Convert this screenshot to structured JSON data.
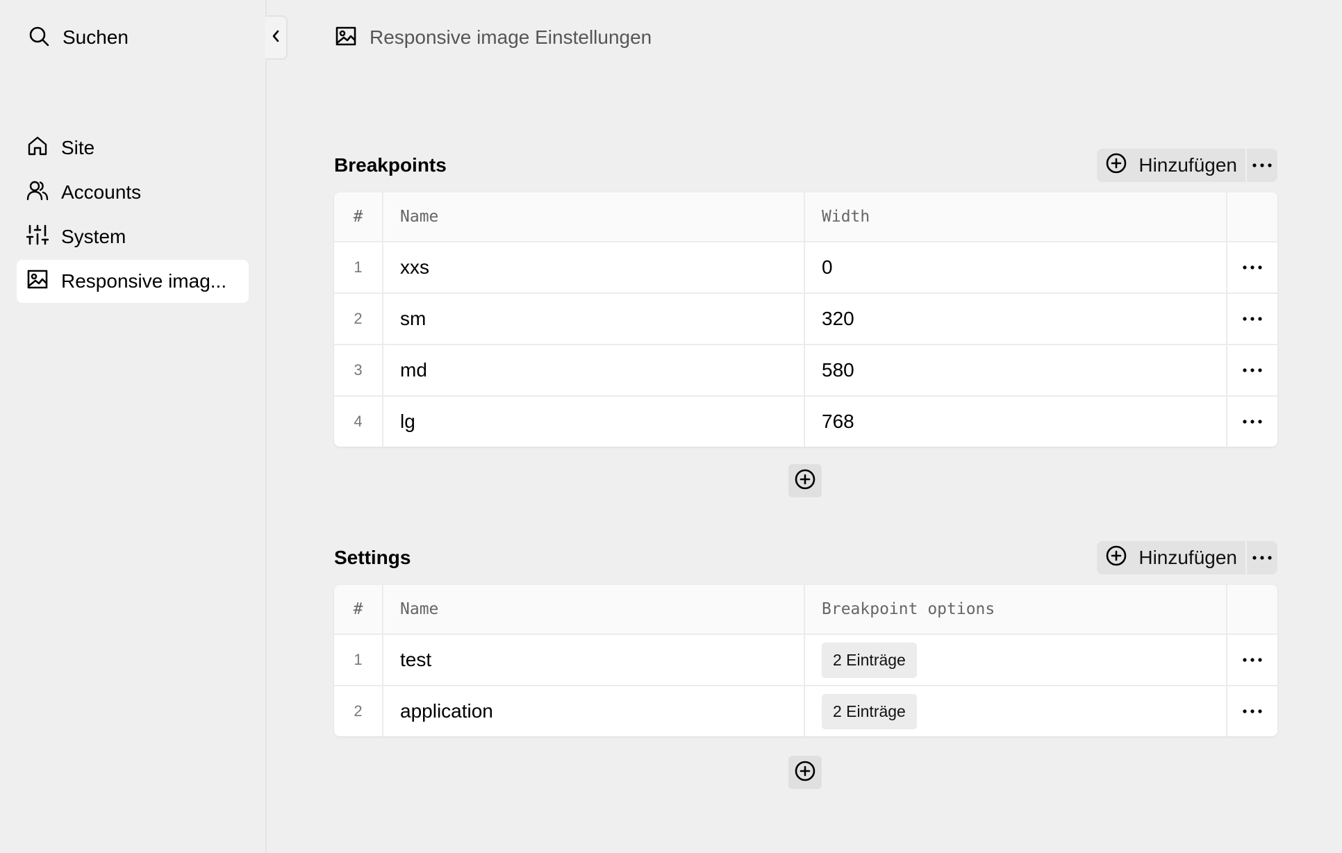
{
  "sidebar": {
    "search_label": "Suchen",
    "items": [
      {
        "label": "Site",
        "icon": "home-icon"
      },
      {
        "label": "Accounts",
        "icon": "users-icon"
      },
      {
        "label": "System",
        "icon": "sliders-icon"
      },
      {
        "label": "Responsive imag...",
        "icon": "image-icon",
        "active": true
      }
    ]
  },
  "header": {
    "title": "Responsive image Einstellungen",
    "icon": "image-icon"
  },
  "breakpoints": {
    "title": "Breakpoints",
    "add_label": "Hinzufügen",
    "columns": [
      "#",
      "Name",
      "Width"
    ],
    "rows": [
      {
        "idx": "1",
        "name": "xxs",
        "value": "0"
      },
      {
        "idx": "2",
        "name": "sm",
        "value": "320"
      },
      {
        "idx": "3",
        "name": "md",
        "value": "580"
      },
      {
        "idx": "4",
        "name": "lg",
        "value": "768"
      }
    ]
  },
  "settings": {
    "title": "Settings",
    "add_label": "Hinzufügen",
    "columns": [
      "#",
      "Name",
      "Breakpoint options"
    ],
    "rows": [
      {
        "idx": "1",
        "name": "test",
        "badge": "2 Einträge"
      },
      {
        "idx": "2",
        "name": "application",
        "badge": "2 Einträge"
      }
    ]
  }
}
